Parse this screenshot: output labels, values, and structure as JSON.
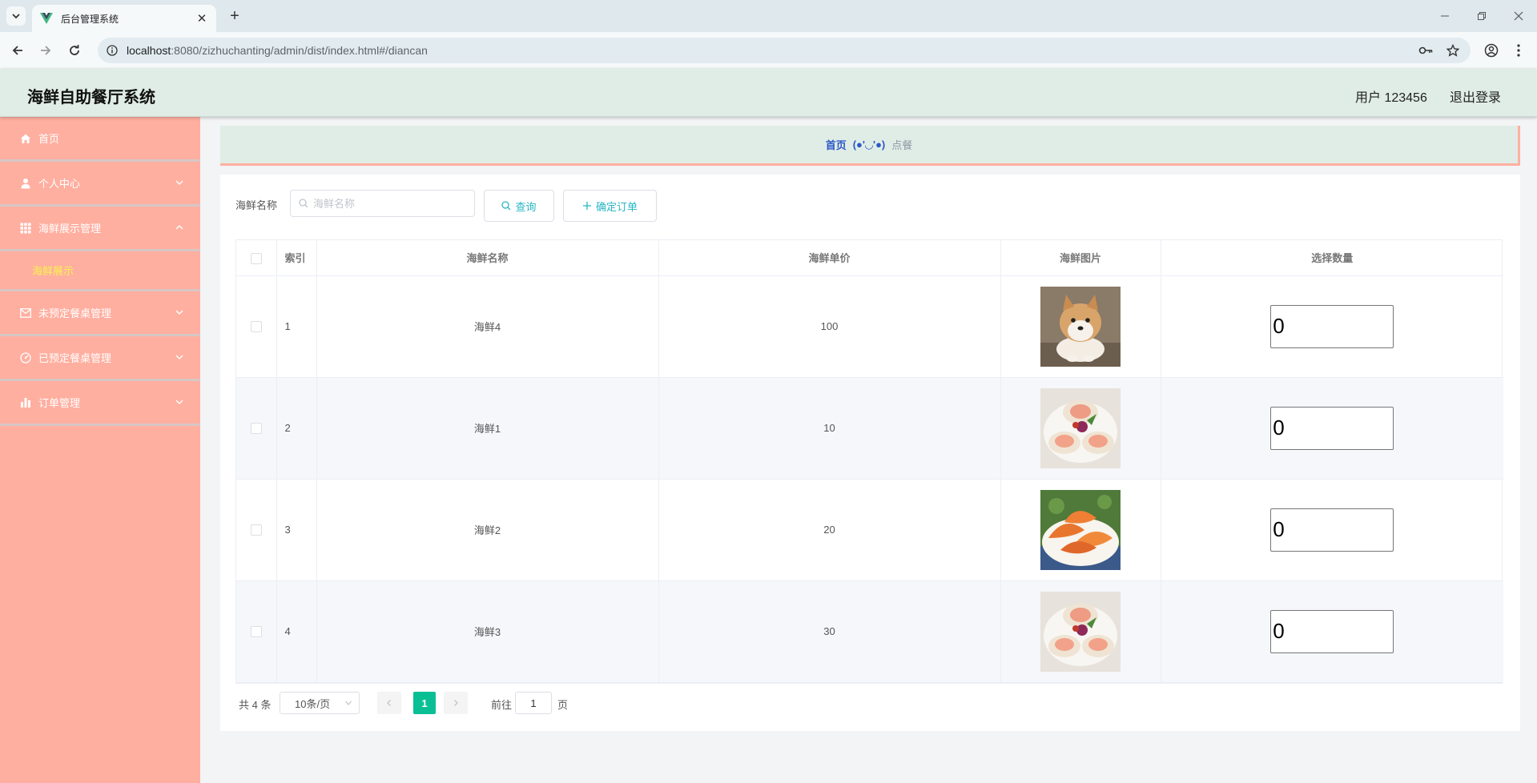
{
  "browser": {
    "tab_title": "后台管理系统",
    "url_host": "localhost",
    "url_rest": ":8080/zizhuchanting/admin/dist/index.html#/diancan"
  },
  "header": {
    "title": "海鲜自助餐厅系统",
    "user": "用户 123456",
    "logout": "退出登录"
  },
  "sidebar": {
    "items": [
      {
        "label": "首页",
        "icon": "home-icon"
      },
      {
        "label": "个人中心",
        "icon": "user-icon",
        "expanded": false
      },
      {
        "label": "海鲜展示管理",
        "icon": "grid-icon",
        "expanded": true
      },
      {
        "label": "未预定餐桌管理",
        "icon": "mail-icon",
        "expanded": false
      },
      {
        "label": "已预定餐桌管理",
        "icon": "gauge-icon",
        "expanded": false
      },
      {
        "label": "订单管理",
        "icon": "bar-chart-icon",
        "expanded": false
      }
    ],
    "sub_item": "海鲜展示"
  },
  "breadcrumb": {
    "home": "首页",
    "sep": "(●'◡'●)",
    "current": "点餐"
  },
  "search": {
    "label": "海鲜名称",
    "placeholder": "海鲜名称",
    "query_btn": "查询",
    "confirm_btn": "确定订单"
  },
  "table": {
    "headers": [
      "索引",
      "海鲜名称",
      "海鲜单价",
      "海鲜图片",
      "选择数量"
    ],
    "rows": [
      {
        "index": "1",
        "name": "海鲜4",
        "price": "100",
        "image": "shiba-dog-photo",
        "qty": "0"
      },
      {
        "index": "2",
        "name": "海鲜1",
        "price": "10",
        "image": "scallops-photo",
        "qty": "0"
      },
      {
        "index": "3",
        "name": "海鲜2",
        "price": "20",
        "image": "shrimp-photo",
        "qty": "0"
      },
      {
        "index": "4",
        "name": "海鲜3",
        "price": "30",
        "image": "scallops-photo",
        "qty": "0"
      }
    ]
  },
  "pagination": {
    "total": "共 4 条",
    "page_size": "10条/页",
    "current_page": "1",
    "goto": "前往",
    "jump_value": "1",
    "page_unit": "页"
  },
  "colors": {
    "sidebar": "#ffafa0",
    "header": "#e0ede6",
    "accent": "#0bbf95",
    "link": "#27b6c4",
    "submenu_active": "#f7f34d"
  }
}
